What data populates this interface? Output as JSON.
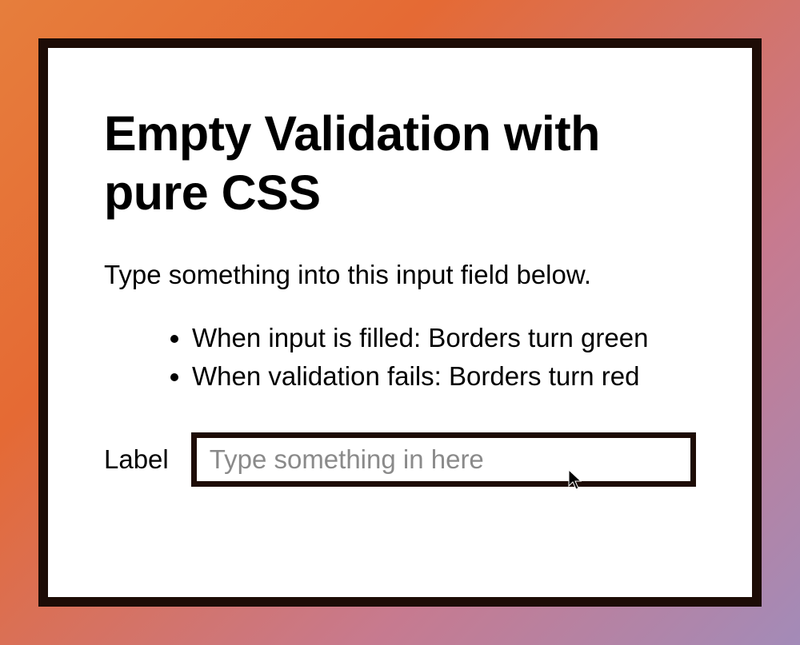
{
  "title": "Empty Validation with pure CSS",
  "subtitle": "Type something into this input field below.",
  "rules": {
    "filled": "When input is filled: Borders turn green",
    "fails": "When validation fails: Borders turn red"
  },
  "form": {
    "label": "Label",
    "placeholder": "Type something in here",
    "value": ""
  }
}
